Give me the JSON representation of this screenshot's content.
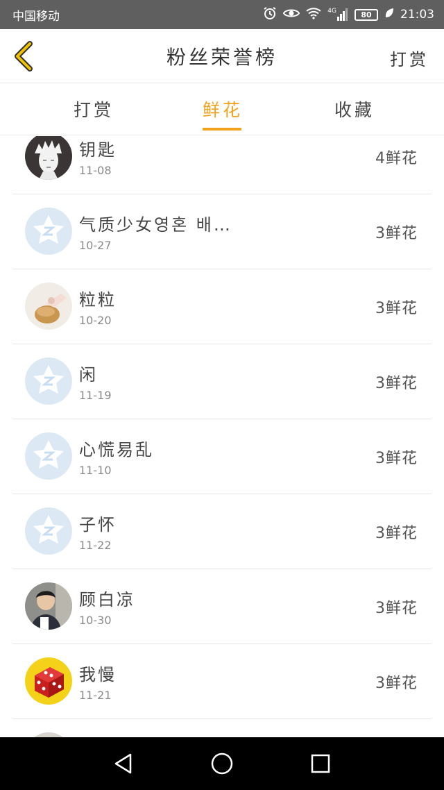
{
  "status_bar": {
    "carrier": "中国移动",
    "network": "4G",
    "battery": "80",
    "time": "21:03",
    "icons": [
      "alarm-icon",
      "eye-icon",
      "wifi-icon",
      "signal-icon",
      "battery-icon",
      "leaf-icon"
    ]
  },
  "header": {
    "title": "粉丝荣誉榜",
    "action_label": "打赏",
    "back_icon": "chevron-left-icon",
    "accent_color": "#f0a21c"
  },
  "tabs": [
    {
      "label": "打赏",
      "active": false
    },
    {
      "label": "鲜花",
      "active": true
    },
    {
      "label": "收藏",
      "active": false
    }
  ],
  "list": [
    {
      "name": "钥匙",
      "date": "11-08",
      "amount": "4鲜花",
      "avatar": "anime-sketch"
    },
    {
      "name": "气质少女영혼 배…",
      "date": "10-27",
      "amount": "3鲜花",
      "avatar": "default-star"
    },
    {
      "name": "粒粒",
      "date": "10-20",
      "amount": "3鲜花",
      "avatar": "bread-photo"
    },
    {
      "name": "闲",
      "date": "11-19",
      "amount": "3鲜花",
      "avatar": "default-star"
    },
    {
      "name": "心慌易乱",
      "date": "11-10",
      "amount": "3鲜花",
      "avatar": "default-star"
    },
    {
      "name": "子怀",
      "date": "11-22",
      "amount": "3鲜花",
      "avatar": "default-star"
    },
    {
      "name": "顾白凉",
      "date": "10-30",
      "amount": "3鲜花",
      "avatar": "person-photo"
    },
    {
      "name": "我慢",
      "date": "11-21",
      "amount": "3鲜花",
      "avatar": "dice-photo"
    }
  ],
  "nav_bar": {
    "icons": [
      "back-triangle-icon",
      "home-circle-icon",
      "recents-square-icon"
    ]
  }
}
